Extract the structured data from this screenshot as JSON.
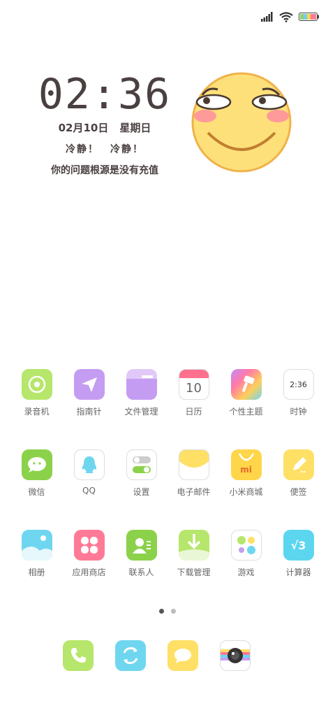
{
  "status_bar": {
    "signal": "signal-icon",
    "wifi": "wifi-icon",
    "battery": "battery-icon"
  },
  "clock": {
    "time": "02:36",
    "date": "02月10日",
    "weekday": "星期日",
    "slogan_1": "冷静！",
    "slogan_2": "冷静！",
    "tagline": "你的问题根源是没有充值"
  },
  "apps": [
    [
      {
        "label": "录音机",
        "icon": "recorder-icon",
        "color": "#b6e66b"
      },
      {
        "label": "指南针",
        "icon": "compass-icon",
        "color": "#c49df2"
      },
      {
        "label": "文件管理",
        "icon": "folder-icon",
        "color": "#c49df2"
      },
      {
        "label": "日历",
        "icon": "calendar-icon",
        "text": "10",
        "color": "#ff6f8e"
      },
      {
        "label": "个性主题",
        "icon": "theme-icon",
        "color": "#ff8ab0"
      },
      {
        "label": "时钟",
        "icon": "clock-icon",
        "text": "2:36",
        "color": "#ffffff"
      }
    ],
    [
      {
        "label": "微信",
        "icon": "wechat-icon",
        "color": "#8bd24a"
      },
      {
        "label": "QQ",
        "icon": "qq-icon",
        "color": "#ffffff"
      },
      {
        "label": "设置",
        "icon": "settings-icon",
        "color": "#ffffff"
      },
      {
        "label": "电子邮件",
        "icon": "mail-icon",
        "color": "#ffe066"
      },
      {
        "label": "小米商城",
        "icon": "mi-store-icon",
        "text": "mi",
        "color": "#ffd54a"
      },
      {
        "label": "便签",
        "icon": "notes-icon",
        "color": "#ffe066"
      }
    ],
    [
      {
        "label": "相册",
        "icon": "gallery-icon",
        "color": "#6fd6ef"
      },
      {
        "label": "应用商店",
        "icon": "app-store-icon",
        "color": "#ff7a96"
      },
      {
        "label": "联系人",
        "icon": "contacts-icon",
        "color": "#8bd24a"
      },
      {
        "label": "下载管理",
        "icon": "download-icon",
        "color": "#b6e66b"
      },
      {
        "label": "游戏",
        "icon": "games-icon",
        "color": "#ffffff"
      },
      {
        "label": "计算器",
        "icon": "calculator-icon",
        "text": "√3",
        "color": "#5cd6ef"
      }
    ]
  ],
  "page_indicator": {
    "count": 2,
    "active": 0
  },
  "dock": [
    {
      "icon": "phone-icon",
      "color": "#b6e66b"
    },
    {
      "icon": "browser-icon",
      "color": "#6fd6ef"
    },
    {
      "icon": "messages-icon",
      "color": "#ffe066"
    },
    {
      "icon": "camera-icon",
      "color": "#ffffff"
    }
  ]
}
